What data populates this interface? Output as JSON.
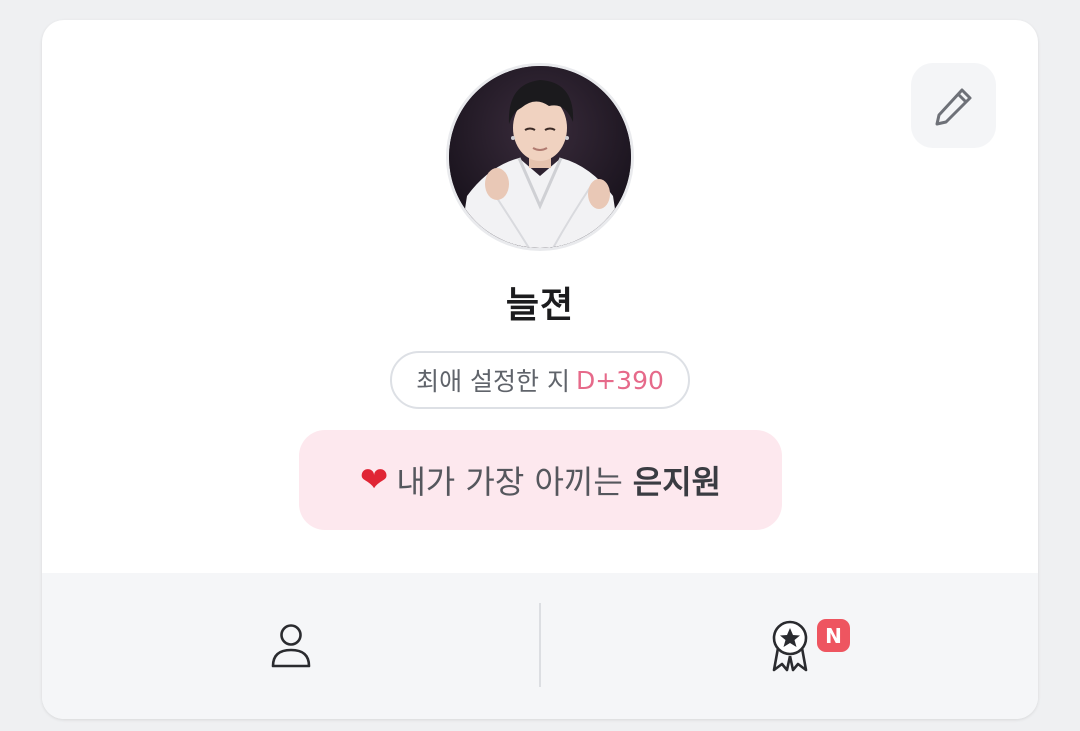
{
  "profile": {
    "nickname": "늘젼",
    "avatar": "profile-photo"
  },
  "dday": {
    "label": "최애 설정한 지",
    "value": "D+390"
  },
  "favorite": {
    "heart_icon": "❤",
    "prefix": "내가 가장 아끼는",
    "name": "은지원"
  },
  "actions": {
    "edit_icon": "pencil-icon"
  },
  "bottom_tabs": [
    {
      "icon": "person-icon"
    },
    {
      "icon": "award-badge-icon",
      "badge": "N"
    }
  ],
  "colors": {
    "accent_pink": "#e66a8a",
    "banner_bg": "#fde8ee",
    "badge_red": "#ee5560"
  }
}
